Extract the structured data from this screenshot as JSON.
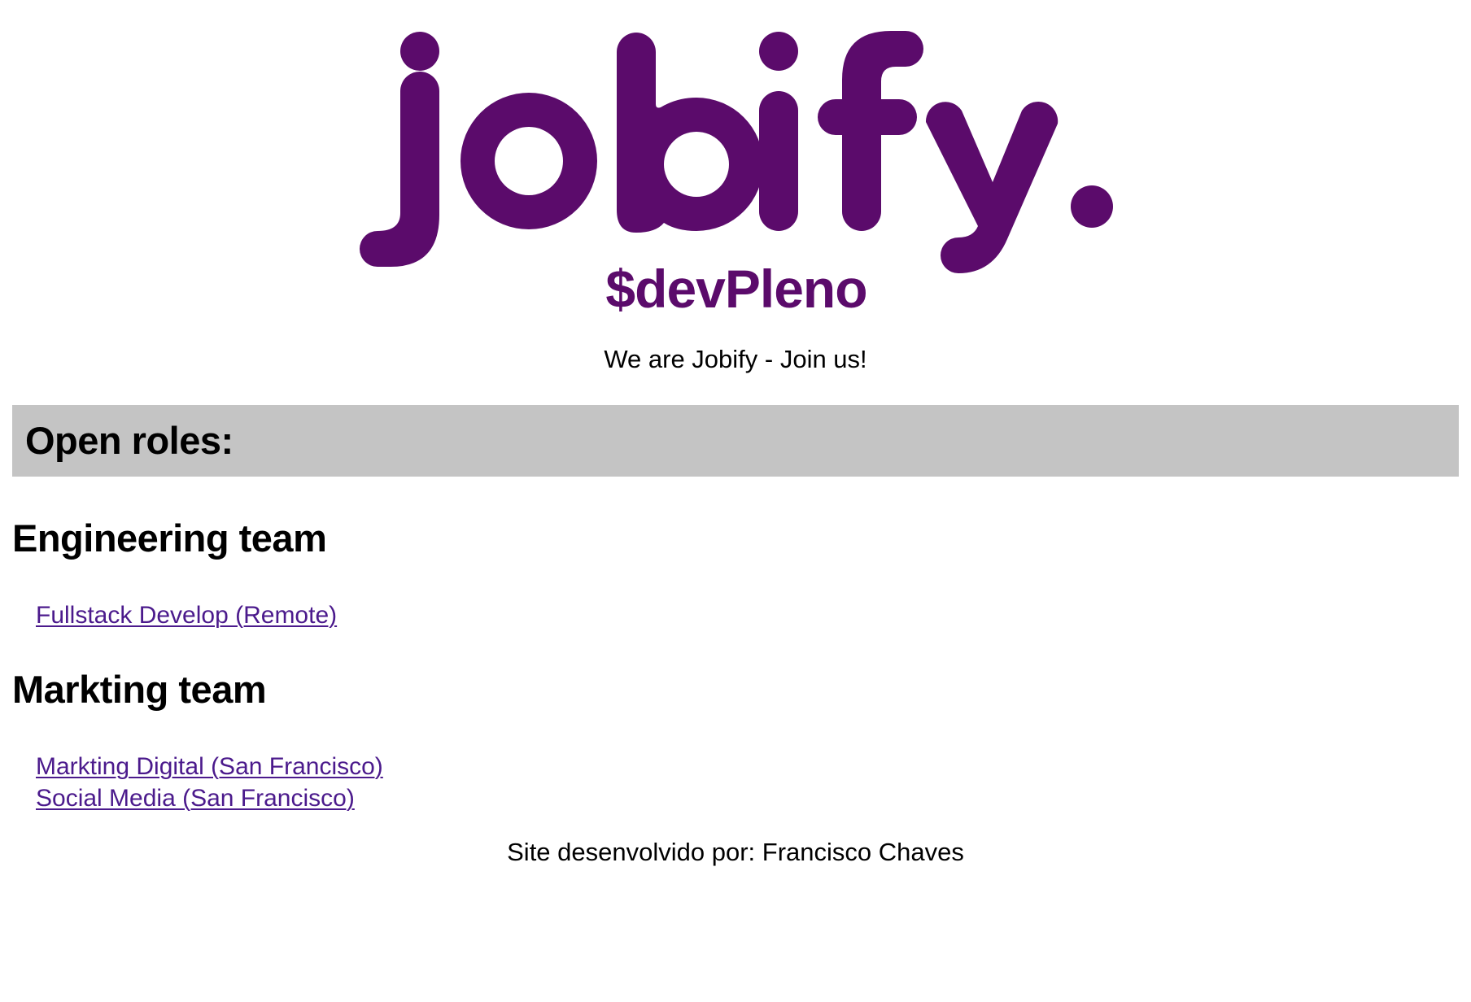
{
  "colors": {
    "brand": "#5b0b6b",
    "link": "#4b1a8c",
    "roles_bar_bg": "#c4c4c4"
  },
  "logo": {
    "wordmark": "jobify.",
    "subtext": "$devPleno"
  },
  "tagline": "We are Jobify - Join us!",
  "open_roles": {
    "title": "Open roles:"
  },
  "teams": [
    {
      "name": "Engineering team",
      "roles": [
        "Fullstack Develop (Remote)"
      ]
    },
    {
      "name": "Markting team",
      "roles": [
        "Markting Digital (San Francisco)",
        "Social Media (San Francisco)"
      ]
    }
  ],
  "footer": {
    "text": "Site desenvolvido por: Francisco Chaves"
  }
}
